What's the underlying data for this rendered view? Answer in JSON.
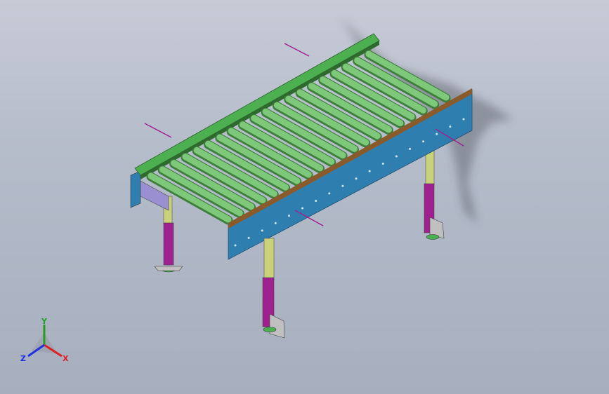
{
  "viewport": {
    "background_top": "#c6cbd6",
    "background_bottom": "#a7afbf"
  },
  "model": {
    "roller_color": "#7ec87a",
    "side_rail_color": "#2e7fb0",
    "guide_rail_color": "#4caf50",
    "leg_upper_color": "#c9d27a",
    "leg_lower_color": "#a0208f",
    "bracket_color": "#c0c0c0"
  },
  "triad": {
    "x_label": "X",
    "y_label": "Y",
    "z_label": "Z",
    "x_color": "#e02020",
    "y_color": "#20a020",
    "z_color": "#2030e0"
  }
}
